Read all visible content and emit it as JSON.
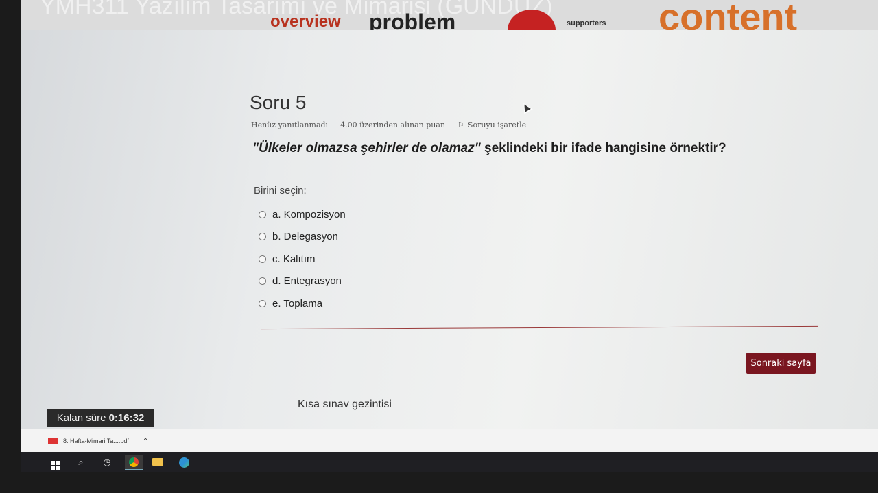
{
  "banner": {
    "course_title": "YMH311 Yazılım Tasarımı ve Mimarisi (GÜNDÜZ)",
    "word_cloud": [
      "overview",
      "problem",
      "supporters",
      "content"
    ]
  },
  "question": {
    "title": "Soru 5",
    "status": "Henüz yanıtlanmadı",
    "points": "4.00 üzerinden alınan puan",
    "flag_label": "Soruyu işaretle",
    "text_quote": "\"Ülkeler olmazsa  şehirler de olamaz\"",
    "text_rest": " şeklindeki bir ifade hangisine örnektir?",
    "prompt": "Birini seçin:",
    "options": [
      "a. Kompozisyon",
      "b. Delegasyon",
      "c. Kalıtım",
      "d. Entegrasyon",
      "e. Toplama"
    ]
  },
  "next_button": "Sonraki sayfa",
  "quiz_nav": "Kısa sınav gezintisi",
  "timer": {
    "label": "Kalan süre ",
    "value": "0:16:32"
  },
  "download": {
    "file": "8. Hafta-Mimari Ta....pdf"
  }
}
